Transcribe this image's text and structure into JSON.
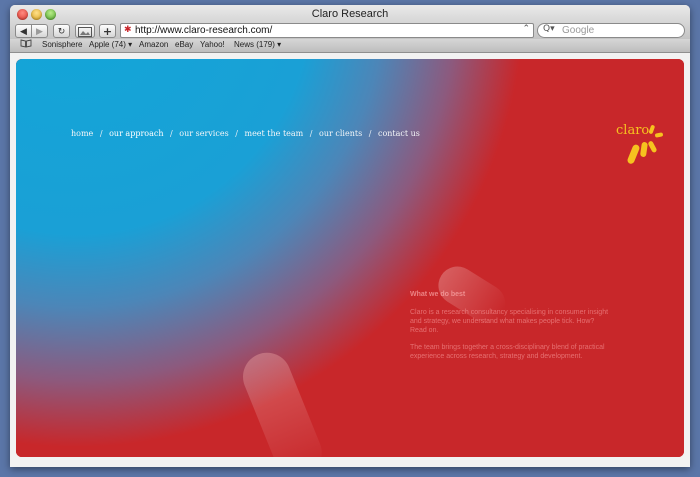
{
  "window": {
    "title": "Claro Research"
  },
  "toolbar": {
    "back_glyph": "◀",
    "forward_glyph": "▶",
    "reload_glyph": "↻",
    "add_glyph": "+",
    "address_url": "http://www.claro-research.com/",
    "address_arrow": "⌃",
    "search_placeholder": "Google",
    "search_icon": "Q▾"
  },
  "bookmarks": {
    "book_icon": "📖",
    "items": [
      {
        "label": "Sonisphere"
      },
      {
        "label": "Apple (74) ▾"
      },
      {
        "label": "Amazon"
      },
      {
        "label": "eBay"
      },
      {
        "label": "Yahoo!"
      },
      {
        "label": "News (179) ▾"
      }
    ]
  },
  "site": {
    "nav": {
      "items": [
        {
          "label": "home"
        },
        {
          "label": "our approach"
        },
        {
          "label": "our services"
        },
        {
          "label": "meet the team"
        },
        {
          "label": "our clients"
        },
        {
          "label": "contact us"
        }
      ],
      "separator": "/"
    },
    "logo_text": "claro",
    "intro": {
      "heading": "What we do best",
      "paragraph_1": "Claro is a research consultancy specialising in consumer insight and strategy, we understand what makes people tick. How? Read on.",
      "paragraph_2": "The team brings together a cross-disciplinary blend of practical experience across research, strategy and development."
    }
  },
  "colors": {
    "brand_red": "#c8272a",
    "brand_cyan": "#12a6d8",
    "logo_yellow": "#f6c21f"
  }
}
